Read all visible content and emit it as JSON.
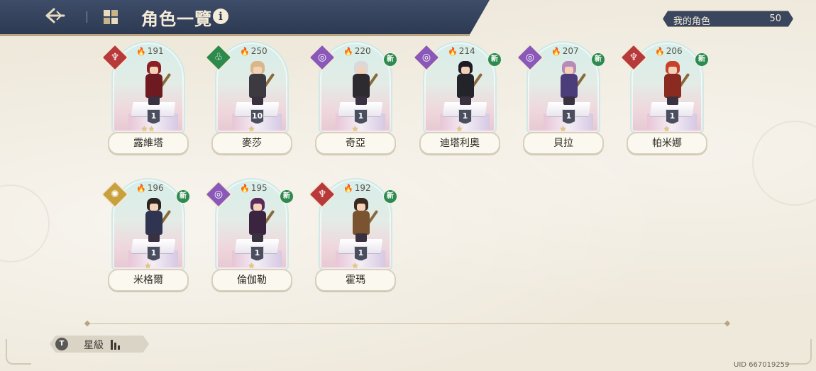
{
  "header": {
    "title": "角色一覽",
    "back_icon": "back-arrow-icon",
    "grid_icon": "grid-icon",
    "info_icon_text": "i"
  },
  "owned": {
    "label": "我的角色",
    "count": "50"
  },
  "characters": [
    {
      "name": "露維塔",
      "power": "191",
      "level": "1",
      "stars": "★★",
      "element": "fire",
      "element_color": "#b8393a",
      "is_new": false,
      "hair": "#8c1f24",
      "outfit": "#6d1a20"
    },
    {
      "name": "麥莎",
      "power": "250",
      "level": "10",
      "stars": "★",
      "element": "wind",
      "element_color": "#2e8a4c",
      "is_new": false,
      "hair": "#d9b78a",
      "outfit": "#3c3a40"
    },
    {
      "name": "奇亞",
      "power": "220",
      "level": "1",
      "stars": "★",
      "element": "dark",
      "element_color": "#8a58b8",
      "is_new": true,
      "new_label": "新",
      "hair": "#d9d9dc",
      "outfit": "#2d2b30"
    },
    {
      "name": "迪塔利奧",
      "power": "214",
      "level": "1",
      "stars": "★",
      "element": "dark",
      "element_color": "#8a58b8",
      "is_new": true,
      "new_label": "新",
      "hair": "#1e1c22",
      "outfit": "#23242a"
    },
    {
      "name": "貝拉",
      "power": "207",
      "level": "1",
      "stars": "★",
      "element": "dark",
      "element_color": "#8a58b8",
      "is_new": true,
      "new_label": "新",
      "hair": "#b88ab8",
      "outfit": "#4b3d7a"
    },
    {
      "name": "帕米娜",
      "power": "206",
      "level": "1",
      "stars": "★",
      "element": "fire",
      "element_color": "#b8393a",
      "is_new": true,
      "new_label": "新",
      "hair": "#c7402c",
      "outfit": "#8a2a20"
    },
    {
      "name": "米格爾",
      "power": "196",
      "level": "1",
      "stars": "★",
      "element": "light",
      "element_color": "#c9a03e",
      "is_new": true,
      "new_label": "新",
      "hair": "#2a2420",
      "outfit": "#2f3550"
    },
    {
      "name": "倫伽勒",
      "power": "195",
      "level": "1",
      "stars": "★",
      "element": "dark",
      "element_color": "#8a58b8",
      "is_new": true,
      "new_label": "新",
      "hair": "#5a2a5a",
      "outfit": "#3a2440"
    },
    {
      "name": "霍瑪",
      "power": "192",
      "level": "1",
      "stars": "★",
      "element": "fire",
      "element_color": "#b8393a",
      "is_new": true,
      "new_label": "新",
      "hair": "#3b2a20",
      "outfit": "#7a5430"
    }
  ],
  "filter": {
    "label": "星級",
    "icon": "filter-icon",
    "icon_text": "T",
    "sort_icon": "sort-bars-icon"
  },
  "uid": "UID 667019259"
}
